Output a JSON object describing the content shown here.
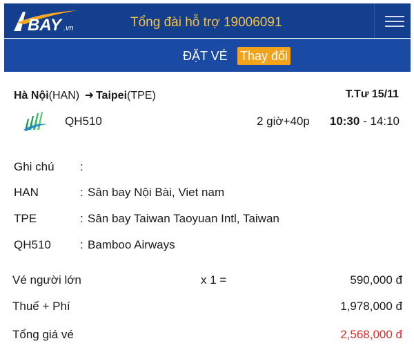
{
  "header": {
    "logo_text": "BAY.vn",
    "hotline": "Tổng đài hỗ trợ 19006091"
  },
  "subheader": {
    "title": "ĐẶT VÉ",
    "change_label": "Thay đổi"
  },
  "flight": {
    "from_city": "Hà Nội",
    "from_code": "(HAN)",
    "arrow": "➜",
    "to_city": "Taipei",
    "to_code": "(TPE)",
    "date": "T.Tư 15/11",
    "flight_no": "QH510",
    "duration": "2 giờ+40p",
    "depart_time": "10:30",
    "time_sep": " - ",
    "arrive_time": "14:10"
  },
  "info": [
    {
      "key": "Ghi chú",
      "colon": ":",
      "value": ""
    },
    {
      "key": "HAN",
      "colon": ":",
      "value": "Sân bay Nội Bài, Viet nam"
    },
    {
      "key": "TPE",
      "colon": ":",
      "value": "Sân bay Taiwan Taoyuan Intl, Taiwan"
    },
    {
      "key": "QH510",
      "colon": ":",
      "value": "Bamboo Airways"
    }
  ],
  "prices": {
    "adult_label": "Vé người lớn",
    "adult_qty": "x 1 =",
    "adult_value": "590,000 đ",
    "tax_label": "Thuế + Phí",
    "tax_value": "1,978,000 đ",
    "total_label": "Tổng giá vé",
    "total_value": "2,568,000 đ"
  },
  "colors": {
    "header_bg": "#143f8f",
    "subheader_bg": "#1a4aa3",
    "hotline": "#f5c242",
    "change_btn": "#f2a21b",
    "total": "#e32b2b"
  },
  "icons": {
    "menu": "hamburger-menu-icon",
    "logo": "abay-logo",
    "airline": "bamboo-airways-logo"
  }
}
